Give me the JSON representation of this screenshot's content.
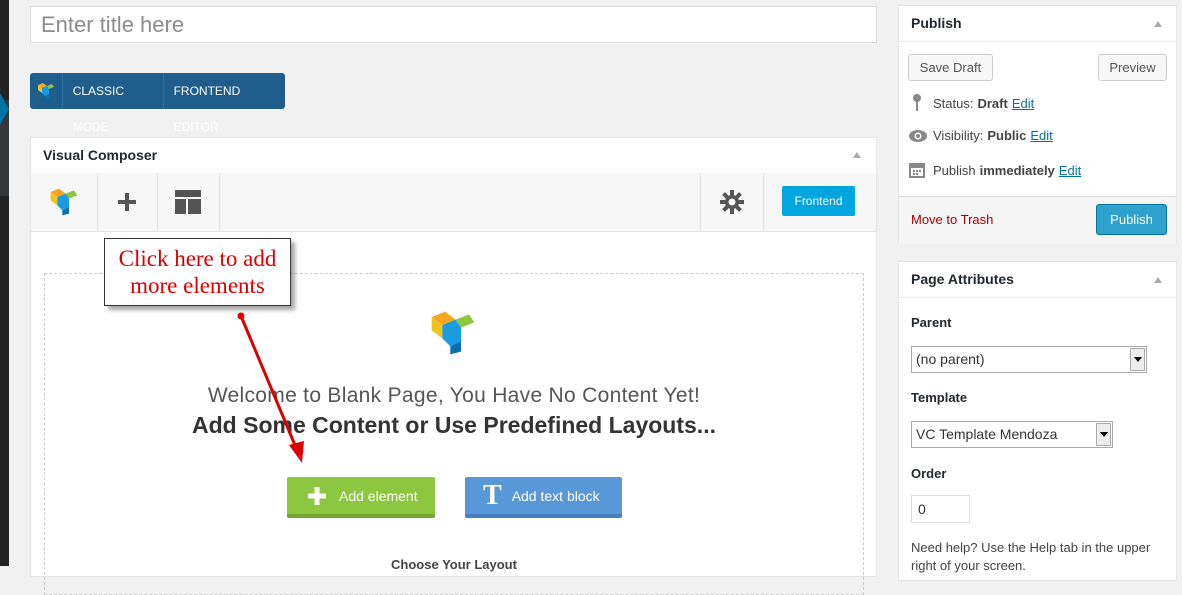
{
  "title": {
    "placeholder": "Enter title here"
  },
  "mode_bar": {
    "classic_mode": "CLASSIC MODE",
    "frontend_editor": "FRONTEND EDITOR"
  },
  "vc": {
    "title": "Visual Composer",
    "frontend_button": "Frontend",
    "welcome_line1": "Welcome to Blank Page, You Have No Content Yet!",
    "welcome_line2": "Add Some Content or Use Predefined Layouts...",
    "add_element": "Add element",
    "add_text_block": "Add text block",
    "choose_layout": "Choose Your Layout",
    "logo_colors": [
      "#f5a623",
      "#8dc63f",
      "#1c9ce0",
      "#0b6fb0"
    ]
  },
  "callout": {
    "line1": "Click here to add",
    "line2": "more elements",
    "color": "#dd0000"
  },
  "publish": {
    "title": "Publish",
    "save_draft": "Save Draft",
    "preview": "Preview",
    "status_label": "Status:",
    "status_value": "Draft",
    "visibility_label": "Visibility:",
    "visibility_value": "Public",
    "publish_label": "Publish",
    "publish_value": "immediately",
    "edit": "Edit",
    "move_to_trash": "Move to Trash",
    "publish_button": "Publish"
  },
  "page_attributes": {
    "title": "Page Attributes",
    "parent_label": "Parent",
    "parent_value": "(no parent)",
    "template_label": "Template",
    "template_value": "VC Template Mendoza",
    "order_label": "Order",
    "order_value": "0",
    "help_text": "Need help? Use the Help tab in the upper right of your screen."
  },
  "icons": [
    "vc-logo-icon",
    "plus-icon",
    "layout-icon",
    "gear-icon",
    "pin-icon",
    "eye-icon",
    "calendar-icon",
    "text-icon"
  ]
}
